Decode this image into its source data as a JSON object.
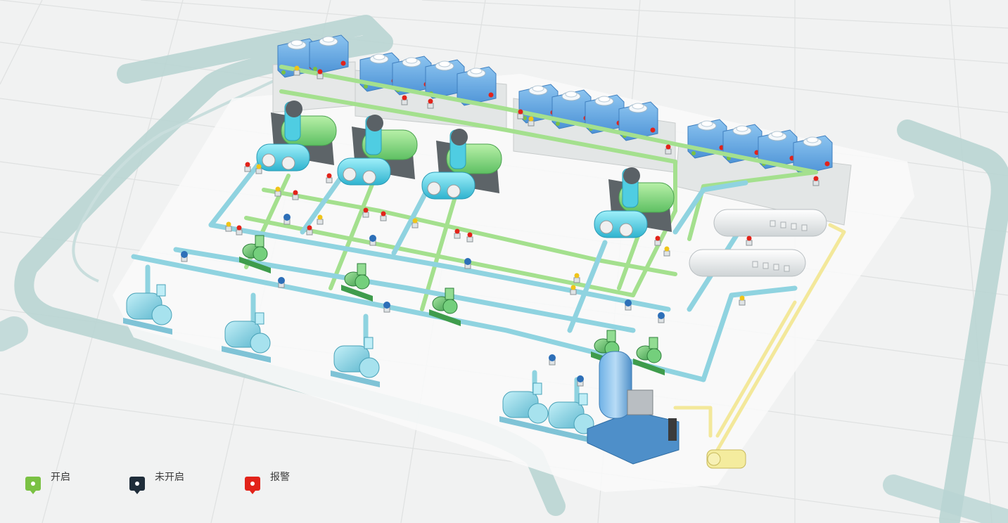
{
  "legend": {
    "items": [
      {
        "label": "开启",
        "color": "#7ac143",
        "icon": "status-on-marker-icon"
      },
      {
        "label": "未开启",
        "color": "#1f2d3a",
        "icon": "status-off-marker-icon"
      },
      {
        "label": "报警",
        "color": "#e2231a",
        "icon": "status-alarm-marker-icon"
      }
    ]
  },
  "colors": {
    "background": "#f1f2f2",
    "grid_line": "#dfe1e1",
    "track": "#b9d5d3",
    "pipe_chilled": "#8fd3e0",
    "pipe_cooling": "#a4e08e",
    "pipe_makeup": "#f3e89a",
    "cooling_tower": "#5ea9e6",
    "chiller_shell": "#7fd37a",
    "chiller_head": "#3ec8e0",
    "pump": "#8ed6e6",
    "pump_green": "#57c06a",
    "valve_red": "#e2231a",
    "valve_blue": "#2d6fb8",
    "valve_yellow": "#f0c419",
    "tank": "#f4f4f4",
    "skid": "#4e8fc9"
  }
}
